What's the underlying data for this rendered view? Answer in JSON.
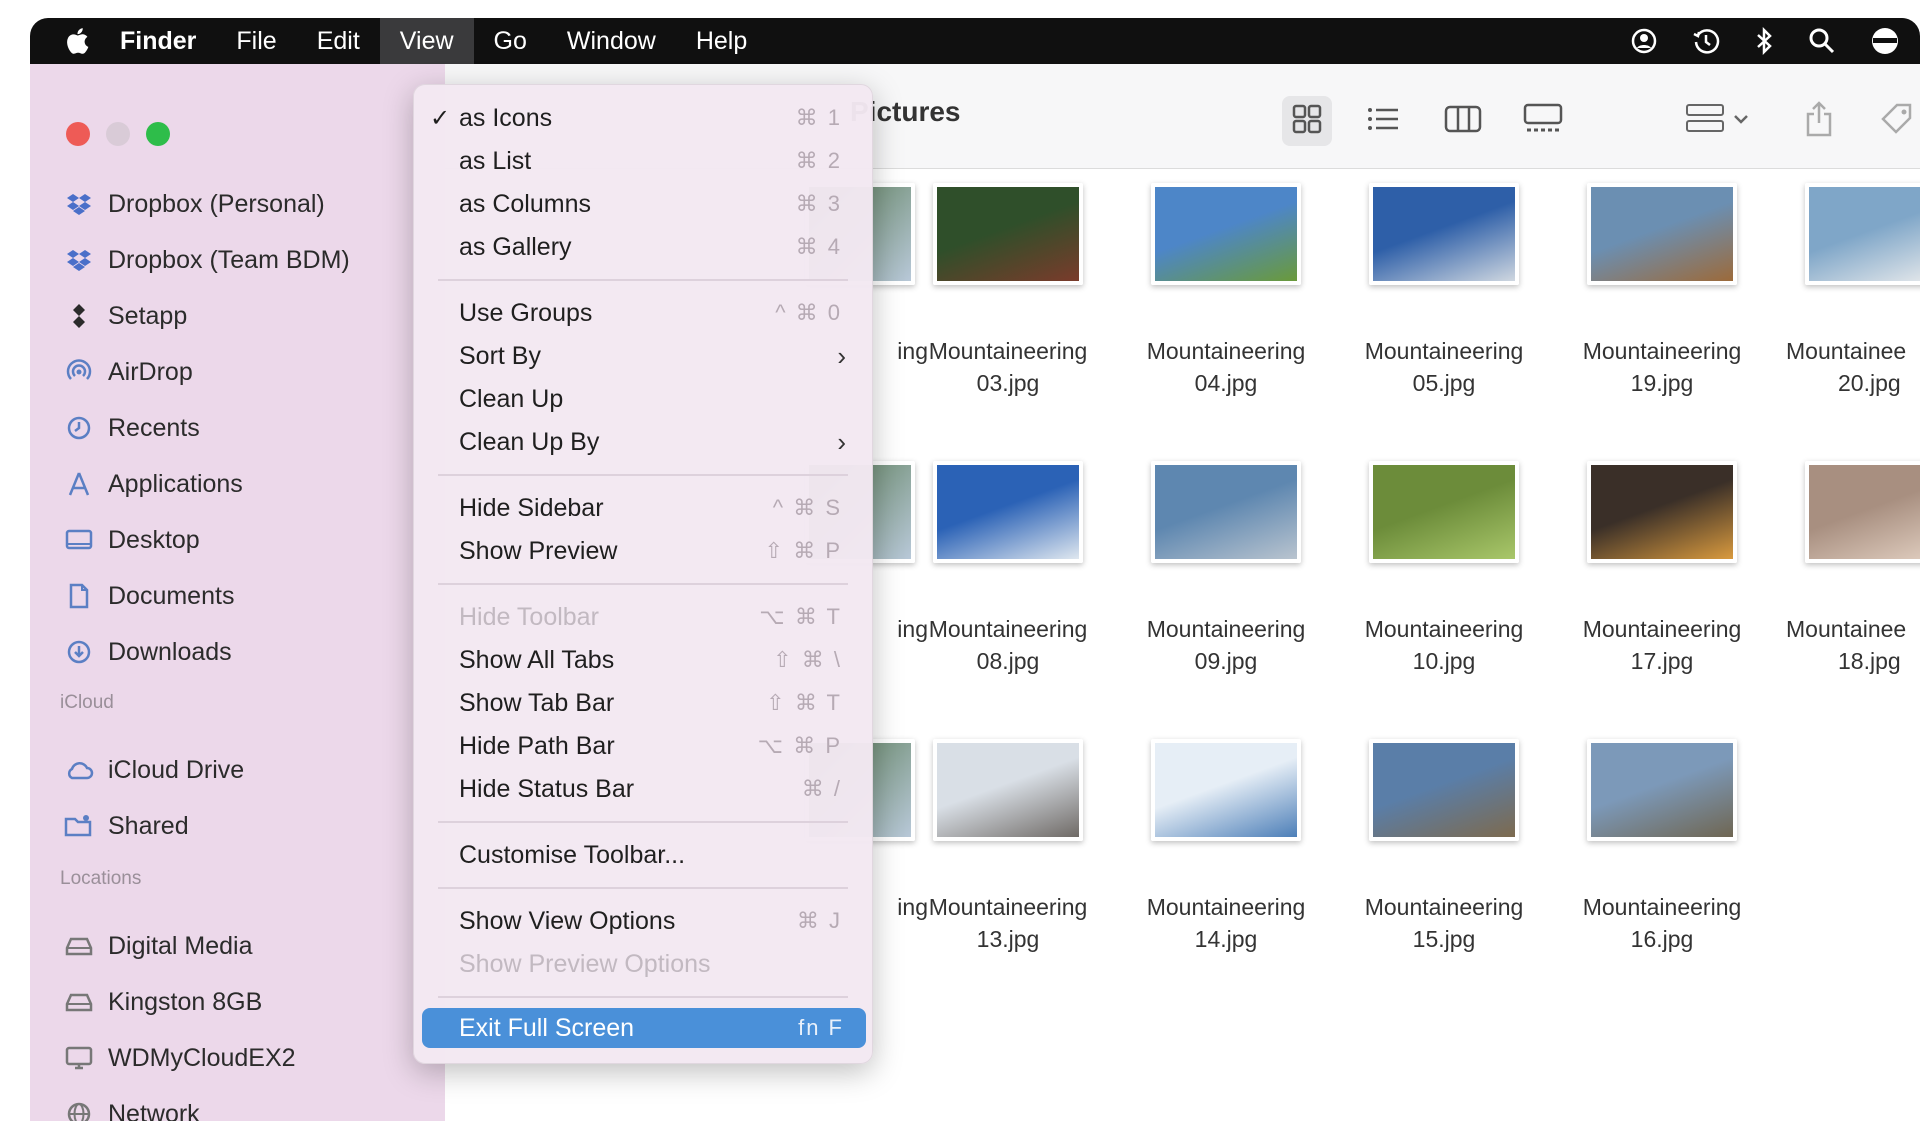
{
  "menubar": {
    "apple_icon": "apple-logo-icon",
    "items": [
      "Finder",
      "File",
      "Edit",
      "View",
      "Go",
      "Window",
      "Help"
    ],
    "status_icons": [
      "user-icon",
      "time-machine-icon",
      "bluetooth-icon",
      "search-icon",
      "control-center-icon"
    ]
  },
  "window": {
    "title": "Pictures"
  },
  "sidebar": {
    "favorites": [
      {
        "label": "Dropbox (Personal)",
        "icon": "dropbox-icon"
      },
      {
        "label": "Dropbox (Team BDM)",
        "icon": "dropbox-icon"
      },
      {
        "label": "Setapp",
        "icon": "setapp-icon"
      },
      {
        "label": "AirDrop",
        "icon": "airdrop-icon"
      },
      {
        "label": "Recents",
        "icon": "clock-icon"
      },
      {
        "label": "Applications",
        "icon": "applications-icon"
      },
      {
        "label": "Desktop",
        "icon": "desktop-icon"
      },
      {
        "label": "Documents",
        "icon": "document-icon"
      },
      {
        "label": "Downloads",
        "icon": "download-icon"
      }
    ],
    "icloud_heading": "iCloud",
    "icloud": [
      {
        "label": "iCloud Drive",
        "icon": "cloud-icon"
      },
      {
        "label": "Shared",
        "icon": "shared-folder-icon"
      }
    ],
    "locations_heading": "Locations",
    "locations": [
      {
        "label": "Digital Media",
        "icon": "drive-icon"
      },
      {
        "label": "Kingston 8GB",
        "icon": "drive-icon"
      },
      {
        "label": "WDMyCloudEX2",
        "icon": "display-icon"
      },
      {
        "label": "Network",
        "icon": "globe-icon"
      }
    ]
  },
  "toolbar": {
    "view_buttons": [
      "icon-view-icon",
      "list-view-icon",
      "column-view-icon",
      "gallery-view-icon"
    ],
    "group_button": "group-icon",
    "share_button": "share-icon",
    "tag_button": "tag-icon"
  },
  "view_menu": {
    "items": [
      {
        "label": "as Icons",
        "shortcut": "⌘ 1",
        "checked": "✓"
      },
      {
        "label": "as List",
        "shortcut": "⌘ 2"
      },
      {
        "label": "as Columns",
        "shortcut": "⌘ 3"
      },
      {
        "label": "as Gallery",
        "shortcut": "⌘ 4"
      },
      {
        "label": "Use Groups",
        "shortcut": "^ ⌘ 0"
      },
      {
        "label": "Sort By",
        "arrow": "›"
      },
      {
        "label": "Clean Up"
      },
      {
        "label": "Clean Up By",
        "arrow": "›"
      },
      {
        "label": "Hide Sidebar",
        "shortcut": "^ ⌘ S"
      },
      {
        "label": "Show Preview",
        "shortcut": "⇧ ⌘ P"
      },
      {
        "label": "Hide Toolbar",
        "shortcut": "⌥ ⌘ T"
      },
      {
        "label": "Show All Tabs",
        "shortcut": "⇧ ⌘ \\"
      },
      {
        "label": "Show Tab Bar",
        "shortcut": "⇧ ⌘ T"
      },
      {
        "label": "Hide Path Bar",
        "shortcut": "⌥ ⌘ P"
      },
      {
        "label": "Hide Status Bar",
        "shortcut": "⌘ /"
      },
      {
        "label": "Customise Toolbar..."
      },
      {
        "label": "Show View Options",
        "shortcut": "⌘ J"
      },
      {
        "label": "Show Preview Options"
      },
      {
        "label": "Exit Full Screen",
        "shortcut": "fn F"
      }
    ]
  },
  "files": {
    "partial_label": "ing",
    "rows": [
      [
        {
          "line1": "Mountaineering",
          "line2": "03.jpg",
          "colors": [
            "#2f4f2a",
            "#7a3b2b"
          ]
        },
        {
          "line1": "Mountaineering",
          "line2": "04.jpg",
          "colors": [
            "#4d86c8",
            "#6a9a3a"
          ]
        },
        {
          "line1": "Mountaineering",
          "line2": "05.jpg",
          "colors": [
            "#2e5fa8",
            "#cfd7e0"
          ]
        },
        {
          "line1": "Mountaineering",
          "line2": "19.jpg",
          "colors": [
            "#6b8fb2",
            "#9c6a3a"
          ]
        },
        {
          "line1": "Mountainee",
          "line2": "20.jpg",
          "colors": [
            "#7fa6c8",
            "#eeeeee"
          ]
        }
      ],
      [
        {
          "line1": "Mountaineering",
          "line2": "08.jpg",
          "colors": [
            "#2b62b6",
            "#dfe7ef"
          ]
        },
        {
          "line1": "Mountaineering",
          "line2": "09.jpg",
          "colors": [
            "#5e87b0",
            "#b9c4cf"
          ]
        },
        {
          "line1": "Mountaineering",
          "line2": "10.jpg",
          "colors": [
            "#6c8c3a",
            "#a9c76a"
          ]
        },
        {
          "line1": "Mountaineering",
          "line2": "17.jpg",
          "colors": [
            "#3a2f28",
            "#d99a3e"
          ]
        },
        {
          "line1": "Mountainee",
          "line2": "18.jpg",
          "colors": [
            "#a88f80",
            "#e4d2c4"
          ]
        }
      ],
      [
        {
          "line1": "Mountaineering",
          "line2": "13.jpg",
          "colors": [
            "#d9dfe6",
            "#6f6a66"
          ]
        },
        {
          "line1": "Mountaineering",
          "line2": "14.jpg",
          "colors": [
            "#e6eef6",
            "#4d7fb8"
          ]
        },
        {
          "line1": "Mountaineering",
          "line2": "15.jpg",
          "colors": [
            "#5a7ea8",
            "#7d6a4e"
          ]
        },
        {
          "line1": "Mountaineering",
          "line2": "16.jpg",
          "colors": [
            "#7c99b9",
            "#6f6652"
          ]
        }
      ]
    ]
  },
  "colors": {
    "menubar": "#101010",
    "sidebar": "#ecd8ea",
    "menu": "#f3e8f2",
    "highlight": "#4a90d9",
    "close": "#ee5b56",
    "minimize": "#d9cbd7",
    "zoom": "#2ebd4a"
  }
}
